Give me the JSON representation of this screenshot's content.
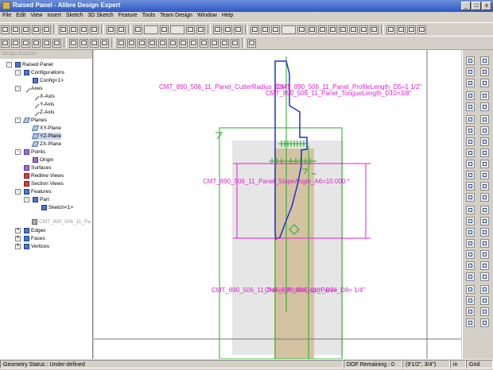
{
  "window": {
    "title": "Raised Panel - Alibre Design Expert"
  },
  "menu": [
    "File",
    "Edit",
    "View",
    "Insert",
    "Sketch",
    "3D Sketch",
    "Feature",
    "Tools",
    "Team Design",
    "Window",
    "Help"
  ],
  "explorer": {
    "title": "Design Explorer",
    "items": [
      {
        "label": "Raised Panel",
        "depth": 0,
        "toggle": "-",
        "icon": "part-icon"
      },
      {
        "label": "Configurations",
        "depth": 1,
        "toggle": "-",
        "icon": "configurations-icon"
      },
      {
        "label": "Config<1>",
        "depth": 2,
        "icon": "config-icon"
      },
      {
        "label": "Axes",
        "depth": 1,
        "toggle": "-",
        "icon": "axes-icon"
      },
      {
        "label": "X-Axis",
        "depth": 2,
        "icon": "axis-icon"
      },
      {
        "label": "Y-Axis",
        "depth": 2,
        "icon": "axis-icon"
      },
      {
        "label": "Z-Axis",
        "depth": 2,
        "icon": "axis-icon"
      },
      {
        "label": "Planes",
        "depth": 1,
        "toggle": "-",
        "icon": "planes-icon"
      },
      {
        "label": "XY-Plane",
        "depth": 2,
        "icon": "plane-icon"
      },
      {
        "label": "YZ-Plane",
        "depth": 2,
        "icon": "plane-icon",
        "selected": true
      },
      {
        "label": "ZX-Plane",
        "depth": 2,
        "icon": "plane-icon"
      },
      {
        "label": "Points",
        "depth": 1,
        "toggle": "-",
        "icon": "points-icon"
      },
      {
        "label": "Origin",
        "depth": 2,
        "icon": "origin-icon"
      },
      {
        "label": "Surfaces",
        "depth": 1,
        "icon": "surfaces-icon"
      },
      {
        "label": "Redline Views",
        "depth": 1,
        "icon": "redline-icon"
      },
      {
        "label": "Section Views",
        "depth": 1,
        "icon": "section-icon"
      },
      {
        "label": "Features",
        "depth": 1,
        "toggle": "-",
        "icon": "features-icon"
      },
      {
        "label": "Part",
        "depth": 2,
        "toggle": "-",
        "icon": "part-feature-icon"
      },
      {
        "label": "Sketch<1>",
        "depth": 3,
        "icon": "sketch-icon"
      },
      {
        "label": "CMT_890_506_11_Pa",
        "depth": 1,
        "icon": "feature-icon",
        "faded": true
      },
      {
        "label": "Edges",
        "depth": 1,
        "toggle": "+",
        "icon": "edges-icon"
      },
      {
        "label": "Faces",
        "depth": 1,
        "toggle": "+",
        "icon": "faces-icon"
      },
      {
        "label": "Vertices",
        "depth": 1,
        "toggle": "+",
        "icon": "vertices-icon"
      }
    ]
  },
  "dimensions": {
    "cutter_radius": "CMT_890_506_11_Panel_CutterRadius_D6=1",
    "profile_length": "CMT_890_506_11_Panel_ProfileLength_D5=1 1/2\"",
    "tongue_length": "CMT_890_506_11_Panel_TongueLength_D10=3/8\"",
    "slope_angle": "CMT_890_506_11_Panel_SlopeAngle_A6=10.000 °",
    "profile_depth": "CMT_890_506_11_Panel_ProfileDepth_D7=",
    "overlap": "CMT_890_506_11_Panel_D8= 1/4\""
  },
  "status": {
    "geometry": "Geometry Status : Under-defined",
    "dof": "DOF Remaining : 0",
    "coords": "(9'1/2\", 3/4\")",
    "units": "in",
    "grid": "Grid"
  },
  "colors": {
    "sketch": "#1f2fd0",
    "dimension": "#e020d0",
    "construction": "#1fae1f",
    "material": "#d4c3a3"
  }
}
